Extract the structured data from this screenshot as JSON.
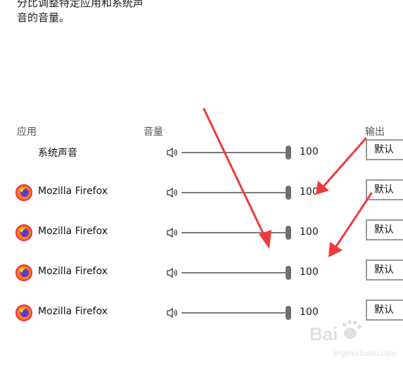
{
  "intro": {
    "line1": "分比调整特定应用和系统声",
    "line2": "音的音量。"
  },
  "headers": {
    "app": "应用",
    "volume": "音量",
    "output": "输出"
  },
  "rows": [
    {
      "name": "系统声音",
      "volume": "100",
      "output": "默认",
      "icon": "none"
    },
    {
      "name": "Mozilla Firefox",
      "volume": "100",
      "output": "默认",
      "icon": "firefox-icon"
    },
    {
      "name": "Mozilla Firefox",
      "volume": "100",
      "output": "默认",
      "icon": "firefox-icon"
    },
    {
      "name": "Mozilla Firefox",
      "volume": "100",
      "output": "默认",
      "icon": "firefox-icon"
    },
    {
      "name": "Mozilla Firefox",
      "volume": "100",
      "output": "默认",
      "icon": "firefox-icon"
    }
  ],
  "watermark": {
    "brand": "Bai",
    "sub": "jingyan.baidu.com"
  },
  "colors": {
    "annotation_arrow": "#f03a3a",
    "slider_thumb": "#6f6f6f",
    "dropdown_border": "#999999"
  }
}
